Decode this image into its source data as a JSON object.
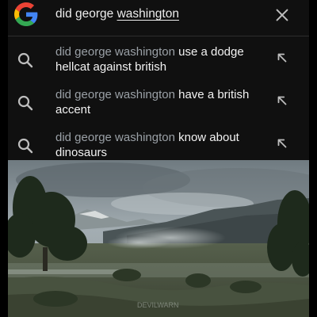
{
  "search": {
    "query_typed": "did george ",
    "query_underlined": "washington",
    "logo_icon": "google-g-icon",
    "clear_icon": "close-icon"
  },
  "suggestions": [
    {
      "prefix": "did george washington",
      "completion": " use a dodge hellcat against british",
      "icon": "search-icon",
      "fill_icon": "arrow-up-left-icon"
    },
    {
      "prefix": "did george washington",
      "completion": " have a british accent",
      "icon": "search-icon",
      "fill_icon": "arrow-up-left-icon"
    },
    {
      "prefix": "did george washington",
      "completion": " know about dinosaurs",
      "icon": "search-icon",
      "fill_icon": "arrow-up-left-icon"
    }
  ],
  "photo": {
    "subject": "landscape-photo",
    "watermark": "DEVILWARN"
  },
  "colors": {
    "panel_bg": "#101010",
    "text_primary": "#f2f2f2",
    "text_prefix": "#9aa0a6",
    "google_blue": "#4285F4",
    "google_red": "#EA4335",
    "google_yellow": "#FBBC05",
    "google_green": "#34A853"
  }
}
